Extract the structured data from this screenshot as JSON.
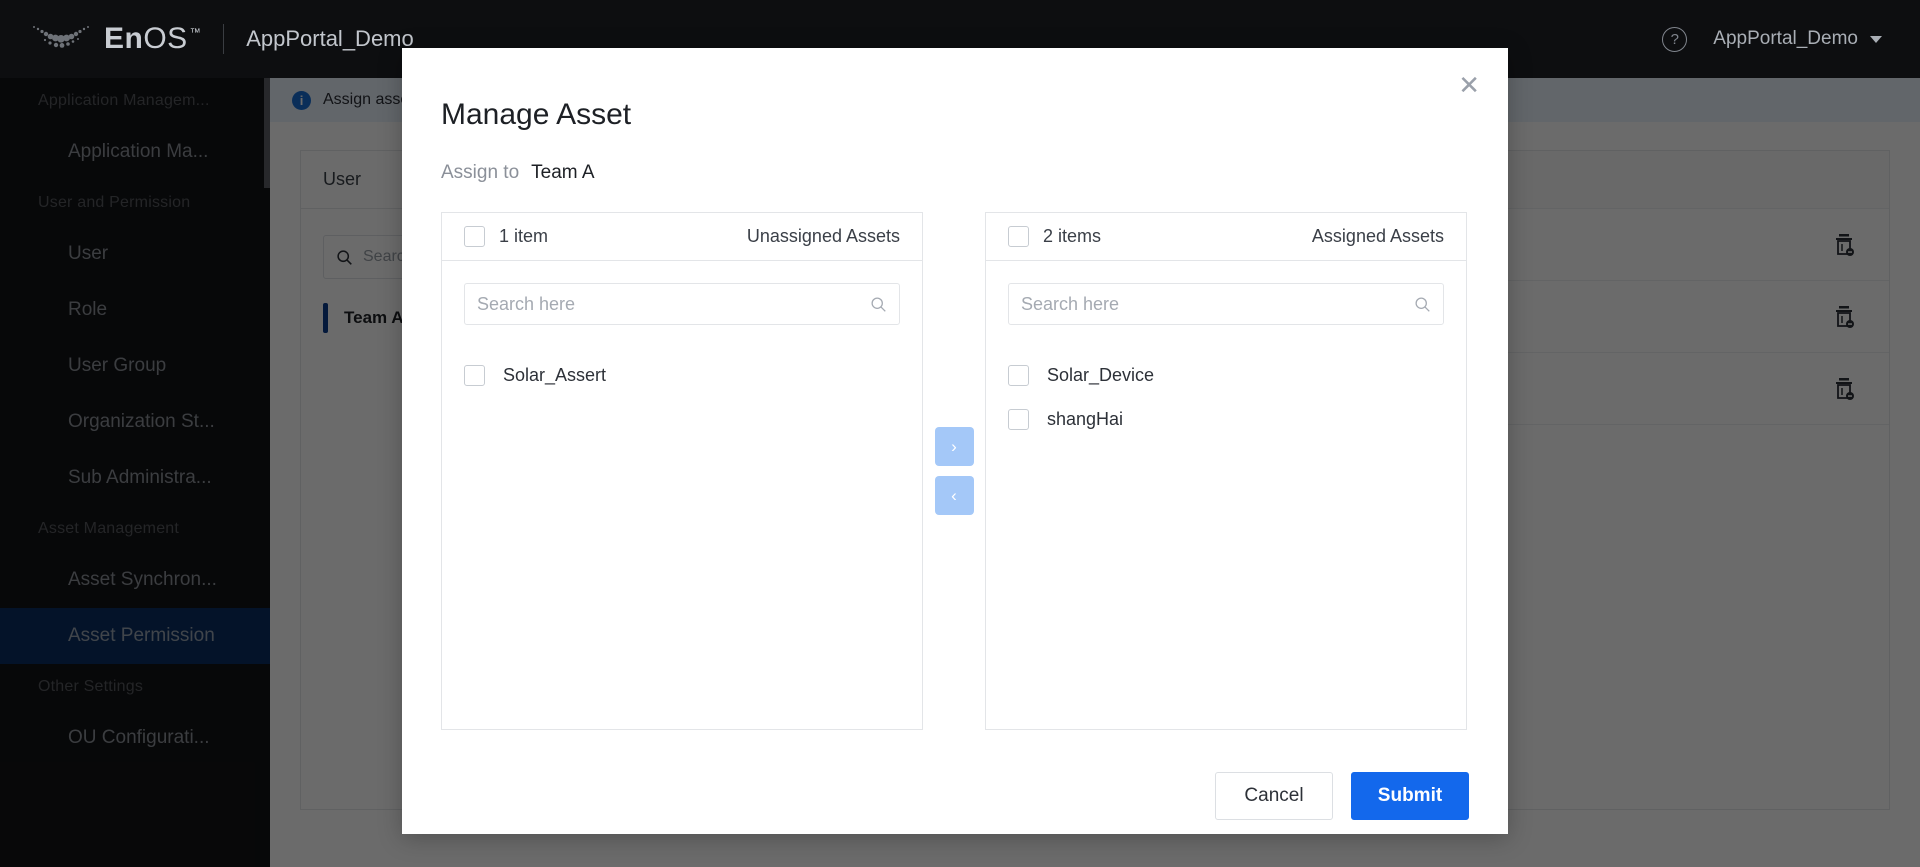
{
  "header": {
    "brand": "EnOS",
    "brand_tm": "™",
    "app_name": "AppPortal_Demo",
    "help_icon": "help-circle-icon",
    "user_name": "AppPortal_Demo",
    "caret_icon": "chevron-down-icon"
  },
  "sidebar": {
    "groups": [
      {
        "label": "Application Managem...",
        "items": [
          {
            "label": "Application Ma...",
            "active": false
          }
        ]
      },
      {
        "label": "User and Permission",
        "items": [
          {
            "label": "User",
            "active": false
          },
          {
            "label": "Role",
            "active": false
          },
          {
            "label": "User Group",
            "active": false
          },
          {
            "label": "Organization St...",
            "active": false
          },
          {
            "label": "Sub Administra...",
            "active": false
          }
        ]
      },
      {
        "label": "Asset Management",
        "items": [
          {
            "label": "Asset Synchron...",
            "active": false
          },
          {
            "label": "Asset Permission",
            "active": true
          }
        ]
      },
      {
        "label": "Other Settings",
        "items": [
          {
            "label": "OU Configurati...",
            "active": false
          }
        ]
      }
    ]
  },
  "main": {
    "alert_text": "Assign assets",
    "alert_icon": "info-icon",
    "left_panel_title": "User",
    "left_search_placeholder": "Search",
    "left_search_icon": "search-icon",
    "team_item": "Team A",
    "row_delete_icon": "trash-icon",
    "rows": [
      "",
      "",
      ""
    ]
  },
  "modal": {
    "title": "Manage Asset",
    "close_icon": "close-icon",
    "assign_label": "Assign to",
    "assign_value": "Team A",
    "panels": [
      {
        "key": "unassigned",
        "count_label": "1 item",
        "title": "Unassigned Assets",
        "header_checkbox": "select-all-checkbox",
        "search_placeholder": "Search here",
        "search_icon": "search-icon",
        "items": [
          {
            "label": "Solar_Assert",
            "checked": false
          }
        ]
      },
      {
        "key": "assigned",
        "count_label": "2 items",
        "title": "Assigned Assets",
        "header_checkbox": "select-all-checkbox",
        "search_placeholder": "Search here",
        "search_icon": "search-icon",
        "items": [
          {
            "label": "Solar_Device",
            "checked": false
          },
          {
            "label": "shangHai",
            "checked": false
          }
        ]
      }
    ],
    "move_right_label": "›",
    "move_left_label": "‹",
    "cancel_label": "Cancel",
    "submit_label": "Submit"
  },
  "colors": {
    "accent_blue": "#1368ec",
    "sidebar_active": "#0b2f62",
    "arrow_button": "#a4c8f8",
    "topbar_bg": "#0d0e10"
  }
}
